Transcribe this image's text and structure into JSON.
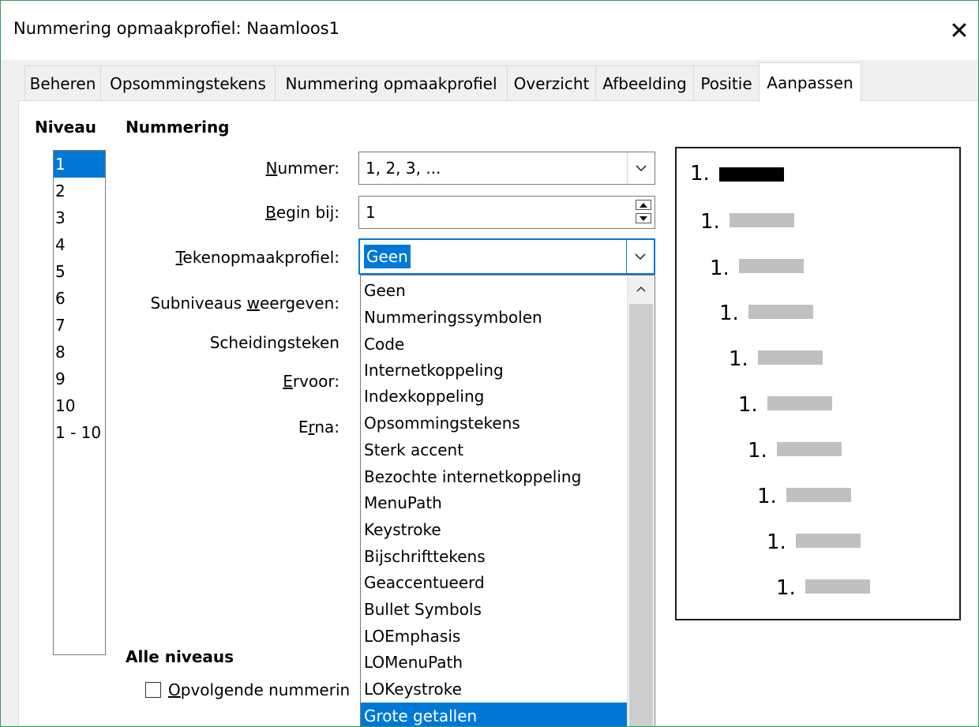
{
  "dialog": {
    "title": "Nummering opmaakprofiel: Naamloos1",
    "close_glyph": "✕"
  },
  "tabs": [
    {
      "label": "Beheren",
      "active": false
    },
    {
      "label": "Opsommingstekens",
      "active": false
    },
    {
      "label": "Nummering opmaakprofiel",
      "active": false
    },
    {
      "label": "Overzicht",
      "active": false
    },
    {
      "label": "Afbeelding",
      "active": false
    },
    {
      "label": "Positie",
      "active": false
    },
    {
      "label": "Aanpassen",
      "active": true
    }
  ],
  "level": {
    "heading": "Niveau",
    "items": [
      "1",
      "2",
      "3",
      "4",
      "5",
      "6",
      "7",
      "8",
      "9",
      "10",
      "1 - 10"
    ],
    "selected": "1"
  },
  "numbering": {
    "heading": "Nummering",
    "number": {
      "label_pre": "",
      "label_u": "N",
      "label_post": "ummer:",
      "value": "1, 2, 3, ..."
    },
    "start_at": {
      "label_pre": "",
      "label_u": "B",
      "label_post": "egin bij:",
      "value": "1"
    },
    "char_style": {
      "label_pre": "",
      "label_u": "T",
      "label_post": "ekenopmaakprofiel:",
      "value": "Geen"
    },
    "sublevels": {
      "label_pre": "Subniveaus ",
      "label_u": "w",
      "label_post": "eergeven:"
    },
    "separator": {
      "label": "Scheidingsteken"
    },
    "before": {
      "label_pre": "",
      "label_u": "E",
      "label_post": "rvoor:"
    },
    "after": {
      "label_pre": "E",
      "label_u": "r",
      "label_post": "na:"
    }
  },
  "char_style_options": {
    "items": [
      "Geen",
      "Nummeringssymbolen",
      "Code",
      "Internetkoppeling",
      "Indexkoppeling",
      "Opsommingstekens",
      "Sterk accent",
      "Bezochte internetkoppeling",
      "MenuPath",
      "Keystroke",
      "Bijschrifttekens",
      "Geaccentueerd",
      "Bullet Symbols",
      "LOEmphasis",
      "LOMenuPath",
      "LOKeystroke",
      "Grote getallen"
    ],
    "highlighted": "Grote getallen"
  },
  "all_levels": {
    "heading": "Alle niveaus",
    "consecutive": {
      "label_u": "O",
      "label_post": "pvolgende nummerin",
      "checked": false
    }
  },
  "preview": {
    "items": [
      "1.",
      "1.",
      "1.",
      "1.",
      "1.",
      "1.",
      "1.",
      "1.",
      "1.",
      "1."
    ],
    "first_bar_color": "#000000",
    "bar_color": "#c0c0c0"
  },
  "colors": {
    "accent": "#0078d7",
    "window_border": "#2f9a5c"
  }
}
